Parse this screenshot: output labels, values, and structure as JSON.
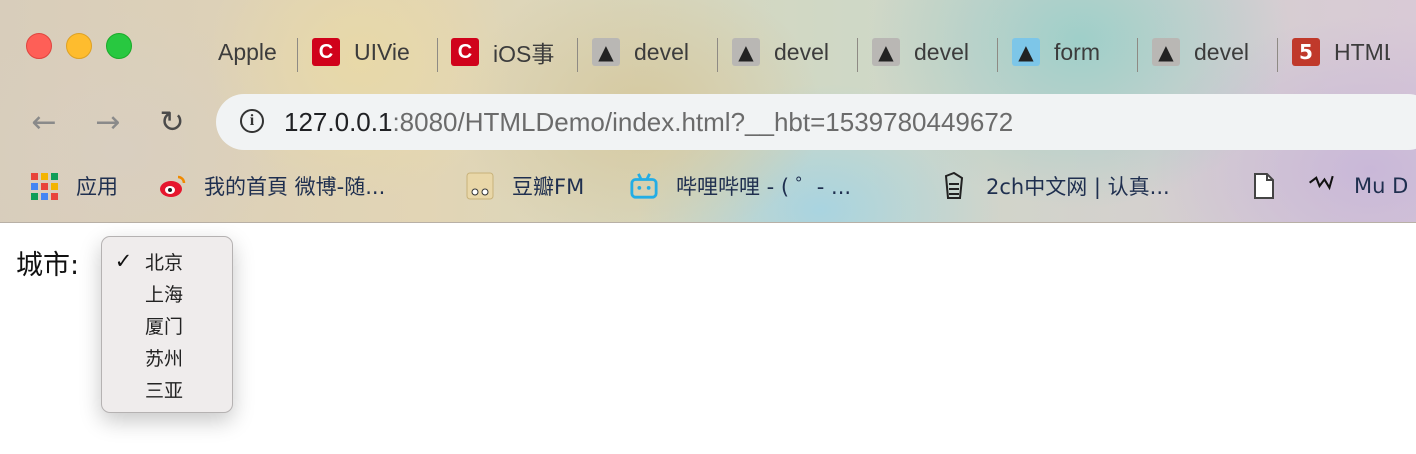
{
  "window": {
    "traffic_lights": [
      "close",
      "minimize",
      "zoom"
    ]
  },
  "tabs": [
    {
      "title": "Apple",
      "icon": "apple-icon"
    },
    {
      "title": "UIVie",
      "icon": "csdn-icon"
    },
    {
      "title": "iOS事",
      "icon": "csdn-icon"
    },
    {
      "title": "devel",
      "icon": "github-icon"
    },
    {
      "title": "devel",
      "icon": "github-icon"
    },
    {
      "title": "devel",
      "icon": "github-icon"
    },
    {
      "title": "form",
      "icon": "github-blue-icon"
    },
    {
      "title": "devel",
      "icon": "github-icon"
    },
    {
      "title": "HTML",
      "icon": "html5-icon"
    }
  ],
  "toolbar": {
    "back_icon": "←",
    "forward_icon": "→",
    "reload_icon": "↻",
    "info_icon": "i"
  },
  "address": {
    "host": "127.0.0.1",
    "rest": ":8080/HTMLDemo/index.html?__hbt=1539780449672"
  },
  "bookmarks": [
    {
      "label": "应用",
      "icon": "apps-grid-icon"
    },
    {
      "label": "我的首頁 微博-随...",
      "icon": "weibo-icon"
    },
    {
      "label": "豆瓣FM",
      "icon": "douban-fm-icon"
    },
    {
      "label": "哔哩哔哩 - ( ゜- ...",
      "icon": "bilibili-icon"
    },
    {
      "label": "2ch中文网 | 认真...",
      "icon": "2ch-icon"
    },
    {
      "label": "",
      "icon": "document-icon"
    },
    {
      "label": "Mu D",
      "icon": "mu-icon"
    }
  ],
  "page": {
    "city_label": "城市:",
    "city_options": [
      "北京",
      "上海",
      "厦门",
      "苏州",
      "三亚"
    ],
    "selected": "北京",
    "check_icon": "✓"
  },
  "colors": {
    "close": "#fe5f57",
    "minimize": "#febc2e",
    "zoom": "#28c840",
    "omnibox": "#f1f3f4",
    "csdn_red": "#d0021b"
  }
}
